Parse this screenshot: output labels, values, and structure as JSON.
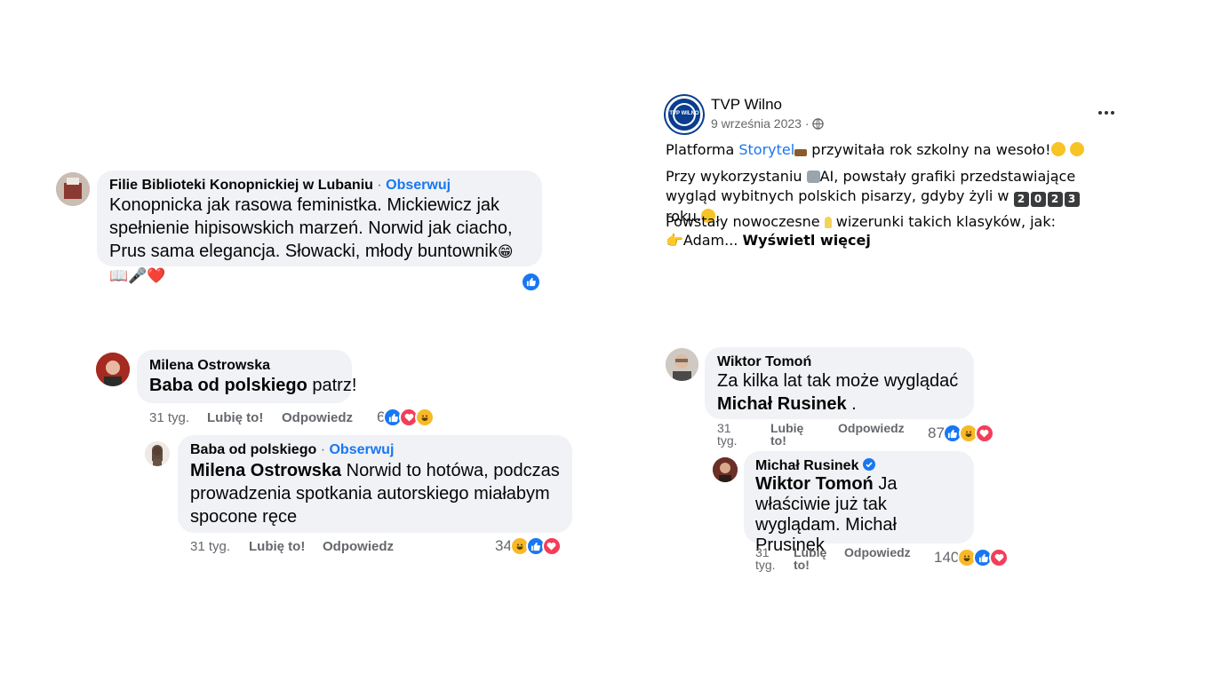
{
  "left": {
    "comment1": {
      "author": "Filie Biblioteki Konopnickiej w Lubaniu",
      "separator": "·",
      "follow": "Obserwuj",
      "text": "Konopnicka jak rasowa feministka. Mickiewicz jak spełnienie hipisowskich marzeń. Norwid jak ciacho, Prus sama elegancja. Słowacki, młody buntownik",
      "emojis": "😁📖🎤❤️"
    },
    "comment2": {
      "author": "Milena Ostrowska",
      "mention": "Baba od polskiego",
      "text": " patrz!",
      "time": "31 tyg.",
      "like": "Lubię to!",
      "reply": "Odpowiedz",
      "reactions_count": "6"
    },
    "reply1": {
      "author": "Baba od polskiego",
      "separator": "·",
      "follow": "Obserwuj",
      "mention": "Milena Ostrowska",
      "text": " Norwid to hotówa, podczas prowadzenia spotkania autorskiego miałabym spocone ręce",
      "time": "31 tyg.",
      "like": "Lubię to!",
      "reply": "Odpowiedz",
      "reactions_count": "34"
    }
  },
  "right": {
    "post": {
      "page_name": "TVP Wilno",
      "logo_text": "TVP WILNO",
      "date": "9 września 2023 ·",
      "line1_a": "Platforma ",
      "line1_link": "Storytel",
      "line1_b": " przywitała rok szkolny na wesoło!",
      "line2_a": "Przy wykorzystaniu ",
      "line2_b": "AI, powstały grafiki przedstawiające wygląd wybitnych polskich pisarzy, gdyby żyli w ",
      "year_digits": [
        "2",
        "0",
        "2",
        "3"
      ],
      "line2_c": " roku.",
      "line3_a": "Powstały nowoczesne ",
      "line3_b": " wizerunki takich klasyków, jak:",
      "line4": "👉Adam... ",
      "see_more": "Wyświetl więcej"
    },
    "comment1": {
      "author": "Wiktor Tomoń",
      "text": "Za kilka lat tak może wyglądać ",
      "mention": "Michał Rusinek",
      "text_end": " .",
      "time": "31 tyg.",
      "like": "Lubię to!",
      "reply": "Odpowiedz",
      "reactions_count": "87"
    },
    "reply1": {
      "author": "Michał Rusinek",
      "mention": "Wiktor Tomoń",
      "text": " Ja właściwie już tak wyglądam. Michał Prusinek",
      "time": "31 tyg.",
      "like": "Lubię to!",
      "reply": "Odpowiedz",
      "reactions_count": "140"
    }
  }
}
